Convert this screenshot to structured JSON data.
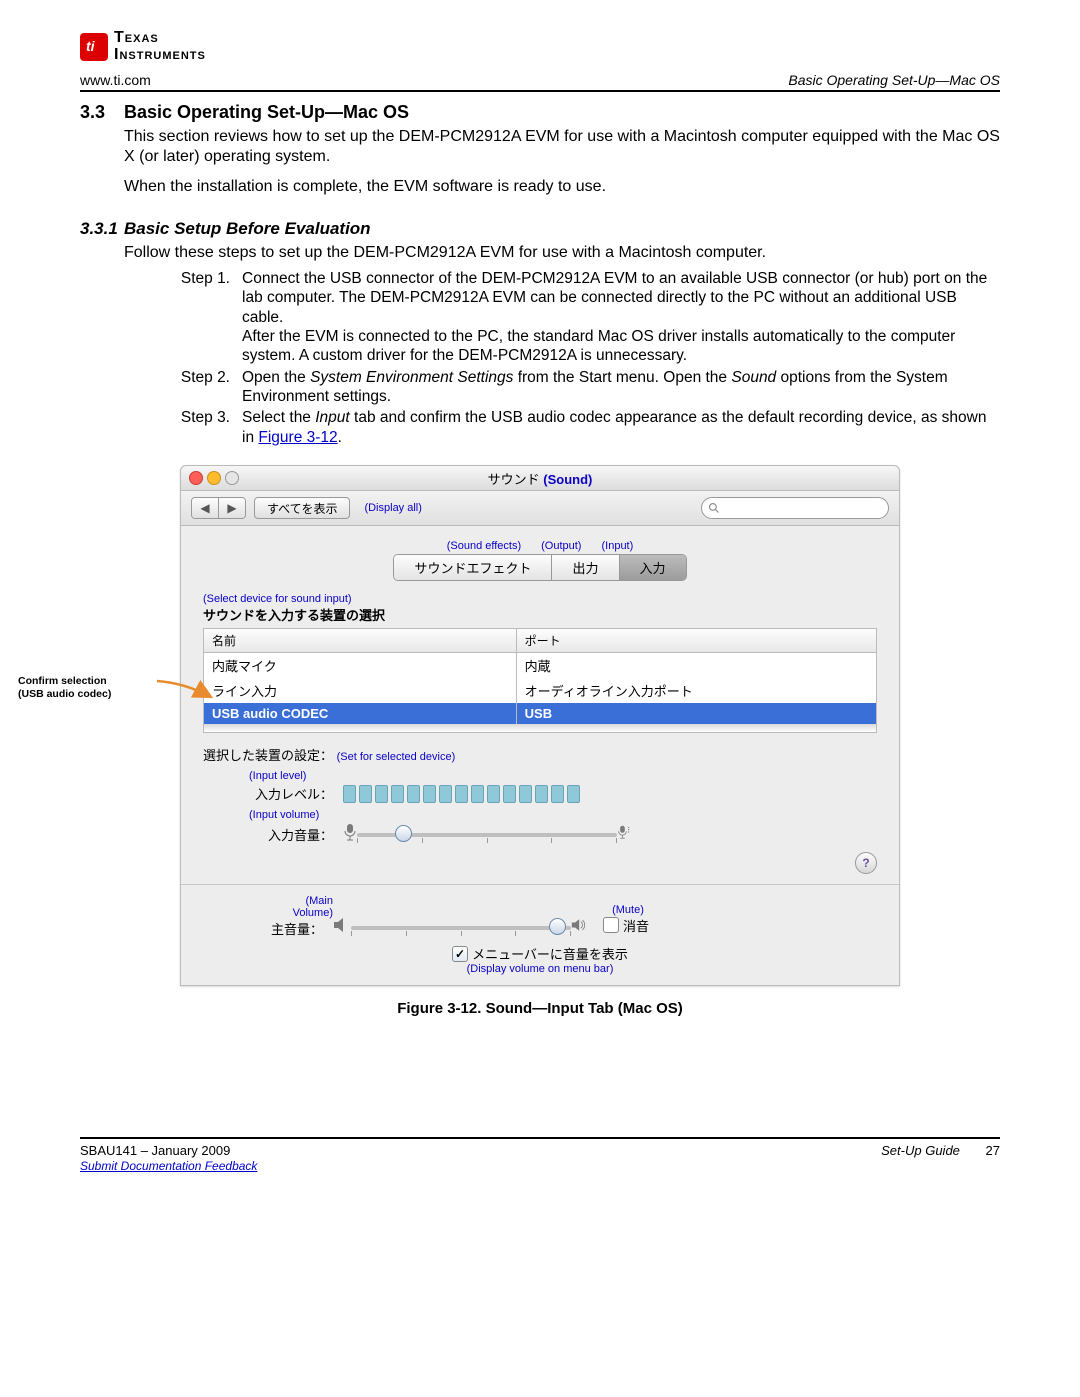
{
  "header": {
    "url": "www.ti.com",
    "section_title_right": "Basic Operating Set-Up—Mac OS",
    "logo_top": "Texas",
    "logo_bottom": "Instruments"
  },
  "section": {
    "number": "3.3",
    "title": "Basic Operating Set-Up—Mac OS",
    "para1": "This section reviews how to set up the DEM-PCM2912A EVM for use with a Macintosh computer equipped with the Mac OS X (or later) operating system.",
    "para2": "When the installation is complete, the EVM software is ready to use."
  },
  "subsection": {
    "number": "3.3.1",
    "title": "Basic Setup Before Evaluation",
    "intro": "Follow these steps to set up the DEM-PCM2912A EVM for use with a Macintosh computer."
  },
  "steps": [
    {
      "label": "Step 1.",
      "text_a": "Connect the USB connector of the DEM-PCM2912A EVM to an available USB connector (or hub) port on the lab computer. The DEM-PCM2912A EVM can be connected directly to the PC without an additional USB cable.",
      "text_b": "After the EVM is connected to the PC, the standard Mac OS driver installs automatically to the computer system. A custom driver for the DEM-PCM2912A is unnecessary."
    },
    {
      "label": "Step 2.",
      "text_a_pre": "Open the ",
      "text_a_em1": "System Environment Settings",
      "text_a_mid": " from the Start menu. Open the ",
      "text_a_em2": "Sound",
      "text_a_post": " options from the System Environment settings."
    },
    {
      "label": "Step 3.",
      "text_a_pre": "Select the ",
      "text_a_em1": "Input",
      "text_a_mid": " tab and confirm the USB audio codec appearance as the default recording device, as shown in ",
      "link_text": "Figure 3-12",
      "text_a_post": "."
    }
  ],
  "callout": {
    "line1": "Confirm selection",
    "line2": "(USB audio codec)"
  },
  "macwin": {
    "title_jp": "サウンド",
    "title_en": "(Sound)",
    "showall_jp": "すべてを表示",
    "showall_en": "(Display all)",
    "tab_en": {
      "fx": "(Sound effects)",
      "out": "(Output)",
      "in": "(Input)"
    },
    "tabs": {
      "fx": "サウンドエフェクト",
      "out": "出力",
      "in": "入力"
    },
    "select_en": "(Select device for sound input)",
    "select_jp": "サウンドを入力する装置の選択",
    "col_name": "名前",
    "col_port": "ポート",
    "rows": [
      {
        "name": "内蔵マイク",
        "port": "内蔵"
      },
      {
        "name": "ライン入力",
        "port": "オーディオライン入力ポート"
      },
      {
        "name": "USB audio CODEC",
        "port": "USB"
      }
    ],
    "setfor_jp": "選択した装置の設定：",
    "setfor_en": "(Set for selected device)",
    "inlevel_en": "(Input level)",
    "inlevel_jp": "入力レベル：",
    "involume_en": "(Input volume)",
    "involume_jp": "入力音量：",
    "mainvol_en_top": "(Main",
    "mainvol_en_bot": "Volume)",
    "mainvol_jp": "主音量：",
    "mute_en": "(Mute)",
    "mute_jp": "消音",
    "menubar_jp": "メニューバーに音量を表示",
    "menubar_en": "(Display volume on menu bar)",
    "help": "?"
  },
  "figure_caption": "Figure 3-12. Sound—Input Tab (Mac OS)",
  "footer": {
    "left": "SBAU141 – January 2009",
    "feedback": "Submit Documentation Feedback",
    "right": "Set-Up Guide",
    "page": "27"
  }
}
